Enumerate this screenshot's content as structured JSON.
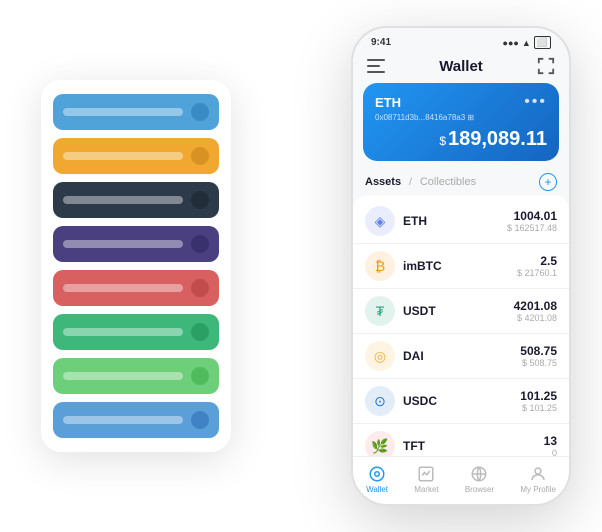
{
  "scene": {
    "cardStack": {
      "cards": [
        {
          "color": "card-blue",
          "dotColor": "dot-blue"
        },
        {
          "color": "card-orange",
          "dotColor": "dot-orange"
        },
        {
          "color": "card-dark",
          "dotColor": "dot-dark"
        },
        {
          "color": "card-purple",
          "dotColor": "dot-purple"
        },
        {
          "color": "card-red",
          "dotColor": "dot-red"
        },
        {
          "color": "card-green",
          "dotColor": "dot-green"
        },
        {
          "color": "card-light-green",
          "dotColor": "dot-lgreen"
        },
        {
          "color": "card-blue2",
          "dotColor": "dot-blue2"
        }
      ]
    },
    "phone": {
      "statusBar": {
        "time": "9:41",
        "signal": "●●●",
        "wifi": "▲",
        "battery": "⬜"
      },
      "header": {
        "menu_icon": "☰",
        "title": "Wallet",
        "expand_icon": "⛶"
      },
      "ethCard": {
        "label": "ETH",
        "dots": "•••",
        "address": "0x08711d3b...8416a78a3 ⊞",
        "currency_symbol": "$",
        "balance": "189,089.11"
      },
      "tabs": {
        "active": "Assets",
        "divider": "/",
        "inactive": "Collectibles",
        "add_btn": "+"
      },
      "assets": [
        {
          "name": "ETH",
          "iconType": "asset-icon-eth",
          "iconChar": "◈",
          "amount": "1004.01",
          "usd": "$ 162517.48"
        },
        {
          "name": "imBTC",
          "iconType": "asset-icon-imbtc",
          "iconChar": "₿",
          "amount": "2.5",
          "usd": "$ 21760.1"
        },
        {
          "name": "USDT",
          "iconType": "asset-icon-usdt",
          "iconChar": "₮",
          "amount": "4201.08",
          "usd": "$ 4201.08"
        },
        {
          "name": "DAI",
          "iconType": "asset-icon-dai",
          "iconChar": "◎",
          "amount": "508.75",
          "usd": "$ 508.75"
        },
        {
          "name": "USDC",
          "iconType": "asset-icon-usdc",
          "iconChar": "⊙",
          "amount": "101.25",
          "usd": "$ 101.25"
        },
        {
          "name": "TFT",
          "iconType": "asset-icon-tft",
          "iconChar": "🌿",
          "amount": "13",
          "usd": "0"
        }
      ],
      "bottomNav": [
        {
          "label": "Wallet",
          "active": true,
          "icon": "○"
        },
        {
          "label": "Market",
          "active": false,
          "icon": "↗"
        },
        {
          "label": "Browser",
          "active": false,
          "icon": "⊕"
        },
        {
          "label": "My Profile",
          "active": false,
          "icon": "⊙"
        }
      ]
    }
  }
}
